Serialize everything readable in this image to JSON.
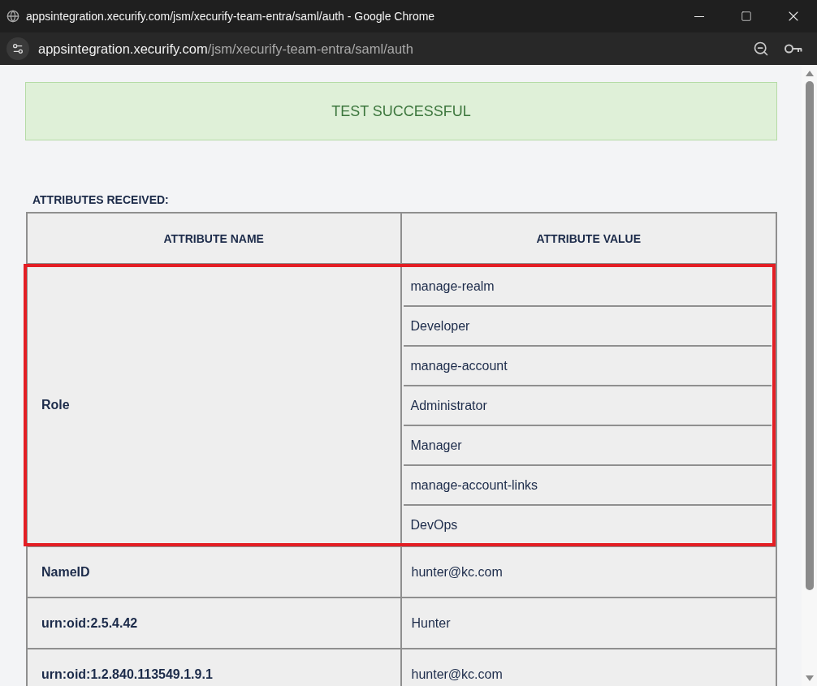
{
  "window": {
    "title": "appsintegration.xecurify.com/jsm/xecurify-team-entra/saml/auth - Google Chrome"
  },
  "address_bar": {
    "host": "appsintegration.xecurify.com",
    "path": "/jsm/xecurify-team-entra/saml/auth"
  },
  "status_banner": {
    "text": "TEST SUCCESSFUL"
  },
  "attributes": {
    "heading": "ATTRIBUTES RECEIVED:",
    "columns": [
      "ATTRIBUTE NAME",
      "ATTRIBUTE VALUE"
    ],
    "rows": [
      {
        "name": "Role",
        "values": [
          "manage-realm",
          "Developer",
          "manage-account",
          "Administrator",
          "Manager",
          "manage-account-links",
          "DevOps"
        ],
        "highlighted": true
      },
      {
        "name": "NameID",
        "values": [
          "hunter@kc.com"
        ],
        "highlighted": false
      },
      {
        "name": "urn:oid:2.5.4.42",
        "values": [
          "Hunter"
        ],
        "highlighted": false
      },
      {
        "name": "urn:oid:1.2.840.113549.1.9.1",
        "values": [
          "hunter@kc.com"
        ],
        "highlighted": false
      }
    ]
  }
}
